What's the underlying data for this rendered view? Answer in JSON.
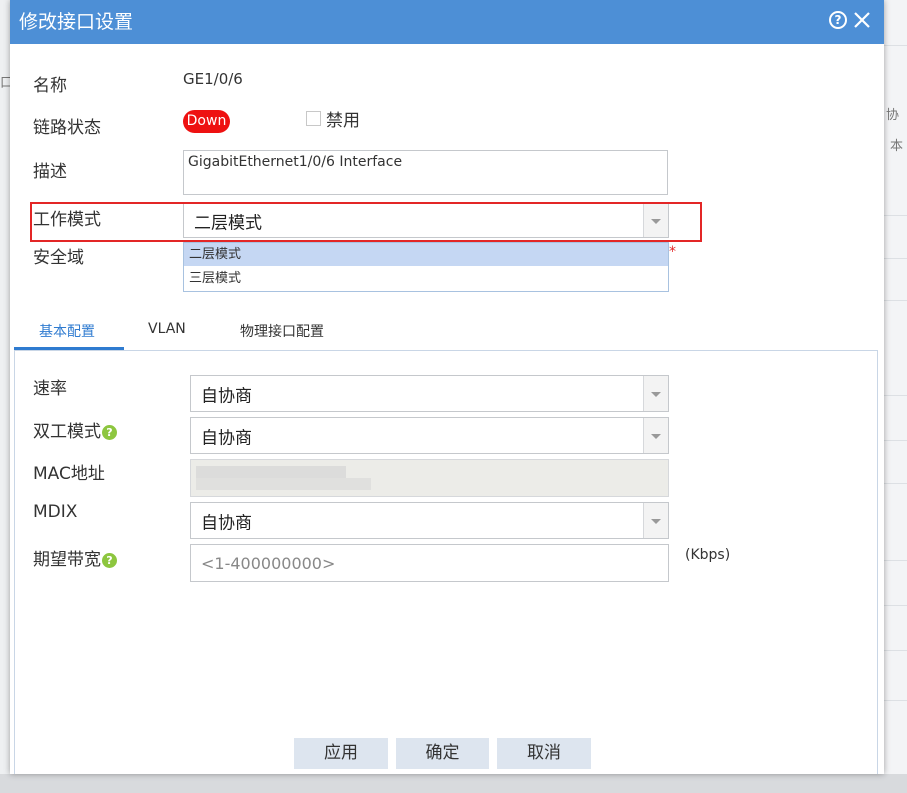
{
  "background": {
    "fragments": [
      "协",
      "本",
      "口"
    ]
  },
  "dialog": {
    "title": "修改接口设置",
    "help_icon": "?",
    "fields": {
      "name_label": "名称",
      "name_value": "GE1/0/6",
      "link_status_label": "链路状态",
      "link_status_value": "Down",
      "disable_label": "禁用",
      "disable_checked": false,
      "description_label": "描述",
      "description_value": "GigabitEthernet1/0/6 Interface",
      "work_mode_label": "工作模式",
      "work_mode_value": "二层模式",
      "work_mode_options": [
        "二层模式",
        "三层模式"
      ],
      "security_zone_label": "安全域",
      "required_mark": "*"
    },
    "tabs": [
      "基本配置",
      "VLAN",
      "物理接口配置"
    ],
    "basic": {
      "speed_label": "速率",
      "speed_value": "自协商",
      "duplex_label": "双工模式",
      "duplex_value": "自协商",
      "mac_label": "MAC地址",
      "mdix_label": "MDIX",
      "mdix_value": "自协商",
      "bandwidth_label": "期望带宽",
      "bandwidth_placeholder": "<1-400000000>",
      "bandwidth_unit": "(Kbps)",
      "help_glyph": "?"
    },
    "buttons": {
      "apply": "应用",
      "ok": "确定",
      "cancel": "取消"
    }
  },
  "colors": {
    "titlebar": "#4d8fd6",
    "status_down": "#ee1111",
    "highlight_border": "#e32626",
    "tab_active": "#2f7bd0",
    "help_green": "#8dc63f"
  }
}
